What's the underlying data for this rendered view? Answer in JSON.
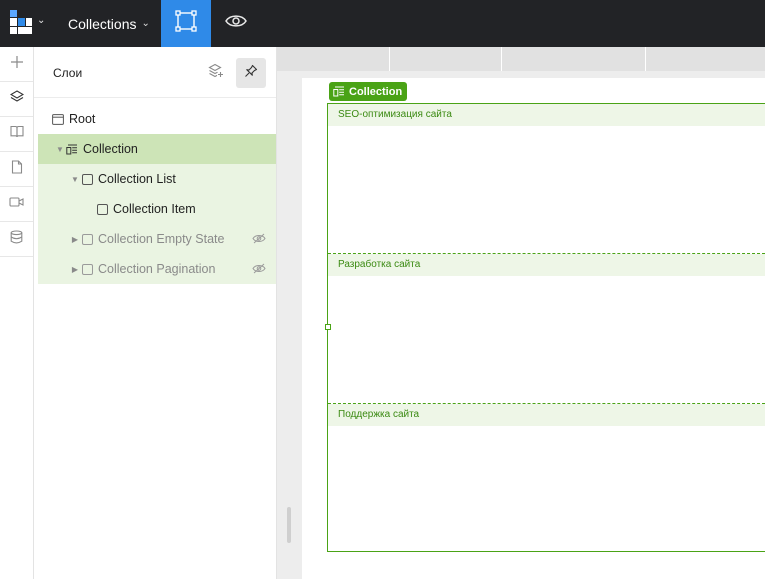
{
  "topbar": {
    "page_name": "Collections",
    "logo_icon": "logo-icon",
    "design_mode_icon": "frame-select-icon",
    "preview_mode_icon": "eye-icon",
    "accent_color": "#2f8ae8"
  },
  "rail": {
    "items": [
      {
        "icon": "plus-icon"
      },
      {
        "icon": "layers-icon"
      },
      {
        "icon": "book-icon"
      },
      {
        "icon": "page-icon"
      },
      {
        "icon": "video-icon"
      },
      {
        "icon": "database-icon"
      }
    ]
  },
  "layers_panel": {
    "title": "Слои",
    "tree": {
      "root": "Root",
      "collection": "Collection",
      "collection_list": "Collection List",
      "collection_item": "Collection Item",
      "empty_state": "Collection Empty State",
      "pagination": "Collection Pagination"
    }
  },
  "canvas": {
    "collection_badge": "Collection",
    "selection_color": "#4aa316",
    "items": [
      {
        "title": "SEO-оптимизация сайта"
      },
      {
        "title": "Разработка сайта"
      },
      {
        "title": "Поддержка сайта"
      }
    ]
  }
}
